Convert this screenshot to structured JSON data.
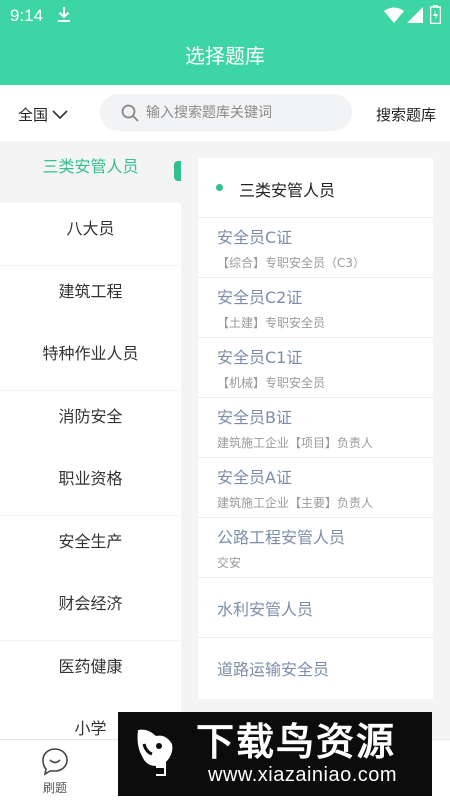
{
  "status_bar": {
    "time": "9:14"
  },
  "header": {
    "title": "选择题库"
  },
  "search": {
    "region": "全国",
    "placeholder": "输入搜索题库关键词",
    "button": "搜索题库"
  },
  "categories": [
    "三类安管人员",
    "八大员",
    "建筑工程",
    "特种作业人员",
    "消防安全",
    "职业资格",
    "安全生产",
    "财会经济",
    "医药健康",
    "小学"
  ],
  "selected_category": "三类安管人员",
  "banks": [
    {
      "name": "安全员C证",
      "sub": "【综合】专职安全员（C3）"
    },
    {
      "name": "安全员C2证",
      "sub": "【土建】专职安全员"
    },
    {
      "name": "安全员C1证",
      "sub": "【机械】专职安全员"
    },
    {
      "name": "安全员B证",
      "sub": "建筑施工企业【项目】负责人"
    },
    {
      "name": "安全员A证",
      "sub": "建筑施工企业【主要】负责人"
    },
    {
      "name": "公路工程安管人员",
      "sub": "交安"
    },
    {
      "name": "水利安管人员",
      "sub": ""
    },
    {
      "name": "道路运输安全员",
      "sub": ""
    }
  ],
  "bottom_nav": {
    "tab1": "刷题"
  },
  "watermark": {
    "title": "下载鸟资源",
    "url": "www.xiazainiao.com"
  },
  "colors": {
    "brand": "#3ed5a5",
    "accent": "#34c08c",
    "link": "#7b8ea8"
  },
  "icons": [
    "download-icon",
    "wifi-icon",
    "signal-icon",
    "battery-icon",
    "chevron-down-icon",
    "search-icon",
    "bubble-icon"
  ]
}
